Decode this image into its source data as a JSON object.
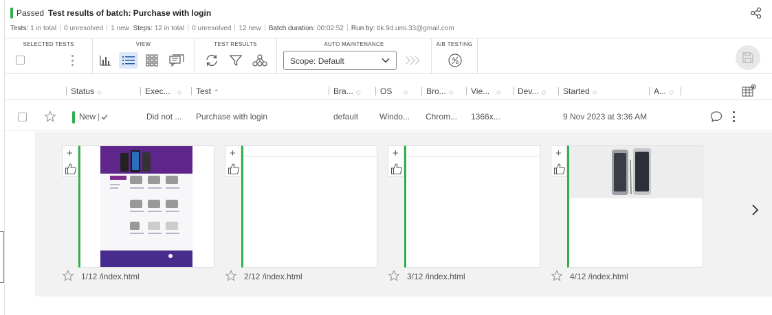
{
  "header": {
    "status": "Passed",
    "title": "Test results of batch:  Purchase with login",
    "stats": {
      "tests_label": "Tests:",
      "tests_total": "1 in total",
      "tests_unresolved": "0 unresolved",
      "tests_new": "1 new",
      "steps_label": "Steps:",
      "steps_total": "12 in total",
      "steps_unresolved": "0 unresolved",
      "steps_new": "12 new",
      "duration_label": "Batch duration:",
      "duration": "00:02:52",
      "runby_label": "Run by:",
      "runby": "tik.9d.umi.33@gmail.com"
    }
  },
  "toolbar": {
    "selected_tests_label": "SELECTED TESTS",
    "view_label": "VIEW",
    "test_results_label": "TEST RESULTS",
    "auto_maintenance_label": "AUTO MAINTENANCE",
    "ab_testing_label": "A/B TESTING",
    "scope_value": "Scope: Default"
  },
  "table": {
    "columns": [
      "Status",
      "Exec...",
      "Test",
      "Bra...",
      "OS",
      "Bro...",
      "Vie...",
      "Dev...",
      "Started",
      "A..."
    ],
    "row": {
      "status": "New",
      "execution": "Did not ...",
      "test": "Purchase with login",
      "branch": "default",
      "os": "Windo...",
      "browser": "Chrom...",
      "viewport": "1366x...",
      "device": "",
      "started": "9 Nov 2023 at 3:36 AM"
    }
  },
  "steps": [
    {
      "caption": "1/12 /index.html"
    },
    {
      "caption": "2/12 /index.html"
    },
    {
      "caption": "3/12 /index.html"
    },
    {
      "caption": "4/12 /index.html"
    }
  ],
  "colors": {
    "pass_green": "#2fb04c",
    "accent_blue": "#2a6fdb",
    "view_active_bg": "#dbe8fa"
  }
}
